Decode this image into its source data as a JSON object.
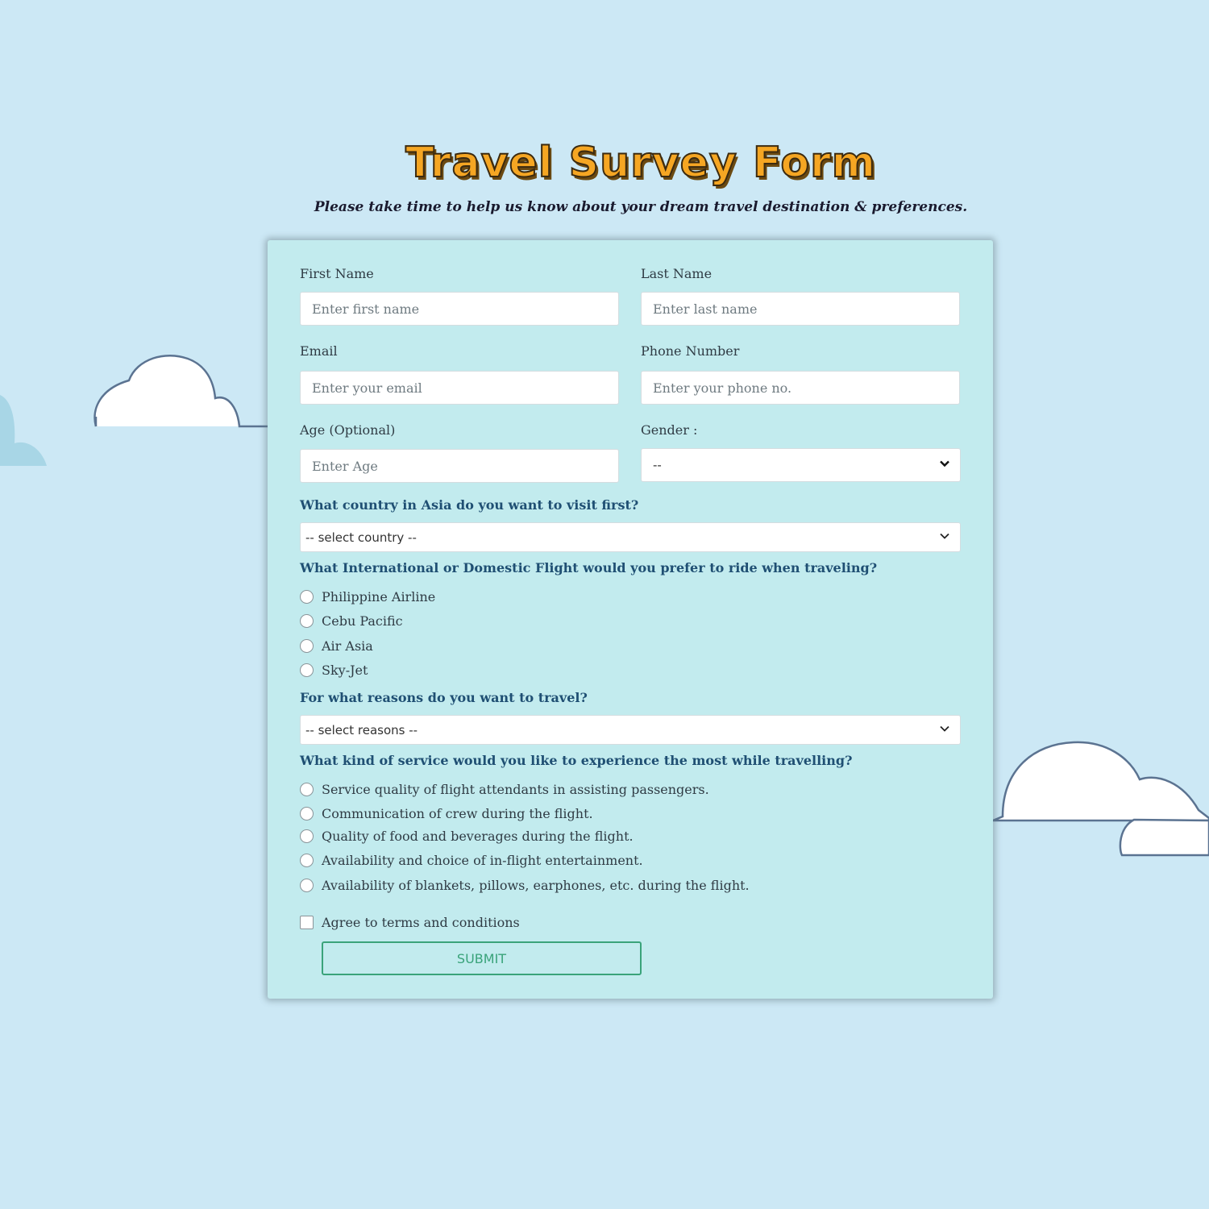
{
  "header": {
    "title": "Travel Survey Form",
    "subtitle": "Please take time to help us know about your dream travel destination & preferences."
  },
  "fields": {
    "first_name": {
      "label": "First Name",
      "placeholder": "Enter first name"
    },
    "last_name": {
      "label": "Last Name",
      "placeholder": "Enter last name"
    },
    "email": {
      "label": "Email",
      "placeholder": "Enter your email"
    },
    "phone": {
      "label": "Phone Number",
      "placeholder": "Enter your phone no."
    },
    "age": {
      "label": "Age (Optional)",
      "placeholder": "Enter Age"
    },
    "gender": {
      "label": "Gender :",
      "selected": "--"
    }
  },
  "country": {
    "question": "What country in Asia do you want to visit first?",
    "selected": "-- select country --"
  },
  "flight": {
    "question": "What International or Domestic Flight would you prefer to ride when traveling?",
    "options": [
      "Philippine Airline",
      "Cebu Pacific",
      "Air Asia",
      "Sky-Jet"
    ]
  },
  "reasons": {
    "question": "For what reasons do you want to travel?",
    "selected": "-- select reasons --"
  },
  "service": {
    "question": "What kind of service would you like to experience the most while travelling?",
    "options": [
      "Service quality of flight attendants in assisting passengers.",
      "Communication of crew during the flight.",
      "Quality of food and beverages during the flight.",
      "Availability and choice of in-flight entertainment.",
      "Availability of blankets, pillows, earphones, etc. during the flight."
    ]
  },
  "terms": {
    "label": "Agree to terms and conditions"
  },
  "submit": {
    "label": "SUBMIT"
  },
  "colors": {
    "background": "#cce8f5",
    "card": "#c2ebee",
    "title": "#f5a623",
    "question": "#1f4f73",
    "submit": "#3aa37a"
  }
}
